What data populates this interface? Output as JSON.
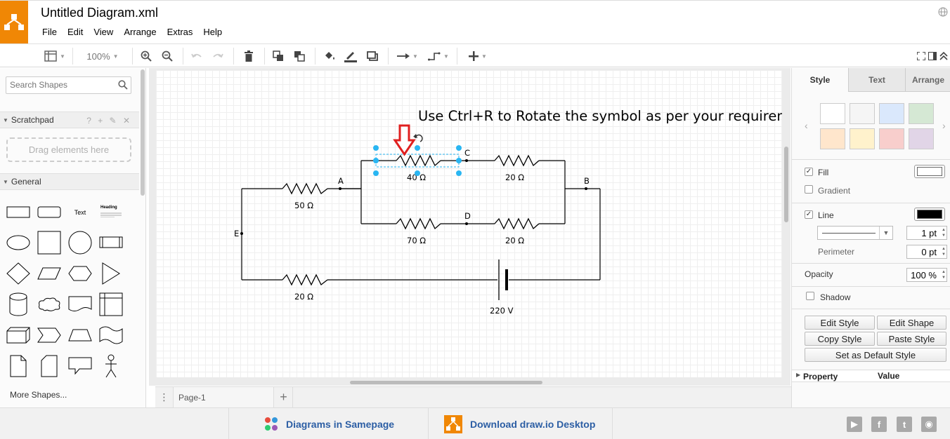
{
  "app": {
    "title": "Untitled Diagram.xml",
    "menu": [
      "File",
      "Edit",
      "View",
      "Arrange",
      "Extras",
      "Help"
    ]
  },
  "toolbar": {
    "zoom": "100%"
  },
  "sidebar": {
    "search_placeholder": "Search Shapes",
    "scratchpad_label": "Scratchpad",
    "scratchpad_tools": "? + ✎ ✕",
    "dropzone_text": "Drag elements here",
    "general_label": "General",
    "text_shape_label": "Text",
    "heading_shape_label": "Heading",
    "more_shapes": "More Shapes..."
  },
  "canvas": {
    "annotation": "Use Ctrl+R to Rotate the symbol as per your requirement",
    "labels": {
      "r50": "50 Ω",
      "r40": "40 Ω",
      "r20a": "20 Ω",
      "r70": "70 Ω",
      "r20b": "20 Ω",
      "r20c": "20 Ω",
      "battery": "220 V",
      "node_a": "A",
      "node_b": "B",
      "node_c": "C",
      "node_d": "D",
      "node_e": "E"
    }
  },
  "pages": {
    "tab": "Page-1"
  },
  "format_panel": {
    "tabs": [
      "Style",
      "Text",
      "Arrange"
    ],
    "swatches": [
      "#ffffff",
      "#f5f5f5",
      "#dae8fc",
      "#d5e8d4",
      "#ffe6cc",
      "#fff2cc",
      "#f8cecc",
      "#e1d5e7"
    ],
    "fill_label": "Fill",
    "fill_color": "#ffffff",
    "gradient_label": "Gradient",
    "line_label": "Line",
    "line_color": "#000000",
    "line_width": "1 pt",
    "perimeter_label": "Perimeter",
    "perimeter_value": "0 pt",
    "opacity_label": "Opacity",
    "opacity_value": "100 %",
    "shadow_label": "Shadow",
    "buttons": {
      "edit_style": "Edit Style",
      "edit_shape": "Edit Shape",
      "copy_style": "Copy Style",
      "paste_style": "Paste Style",
      "set_default": "Set as Default Style"
    },
    "property_header": "Property",
    "value_header": "Value"
  },
  "footer": {
    "samepage": "Diagrams in Samepage",
    "desktop": "Download draw.io Desktop"
  },
  "colors": {
    "brand": "#f08705",
    "selection": "#29b6f2",
    "arrow": "#e02020",
    "link": "#2c5ea4"
  }
}
